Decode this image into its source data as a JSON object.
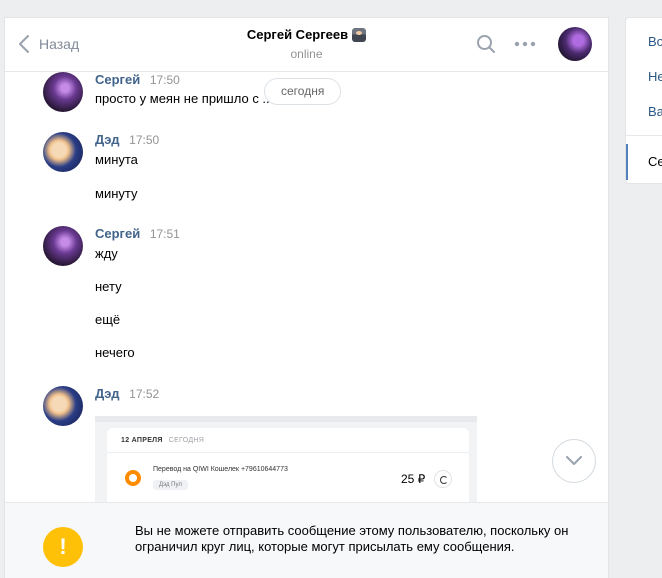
{
  "header": {
    "back_label": "Назад",
    "peer_name": "Сергей Сергеев",
    "peer_status": "online"
  },
  "date_separator": "сегодня",
  "messages": [
    {
      "author": "Сергей",
      "time": "17:50",
      "lines": [
        "просто у меян не пришло с ..."
      ]
    },
    {
      "author": "Дэд",
      "time": "17:50",
      "lines": [
        "минута",
        "минуту"
      ]
    },
    {
      "author": "Сергей",
      "time": "17:51",
      "lines": [
        "жду",
        "нету",
        "ещё",
        "нечего"
      ]
    },
    {
      "author": "Дэд",
      "time": "17:52",
      "attachment": {
        "date": "12 АПРЕЛЯ",
        "date_note": "СЕГОДНЯ",
        "description": "Перевод на QIWI Кошелек +79610644773",
        "tag": "Дэд Пул",
        "amount": "25 ₽"
      }
    }
  ],
  "footer": {
    "warning_icon_glyph": "!",
    "warning_text": "Вы не можете отправить сообщение этому пользователю, поскольку он ограничил круг лиц, которые могут присылать ему сообщения."
  },
  "side_menu": {
    "items": [
      "Во",
      "Не",
      "Ва",
      "Се"
    ]
  },
  "colors": {
    "link": "#42648b",
    "warning": "#ffc107",
    "accent": "#5181b8"
  },
  "icons": [
    "chevron-left-icon",
    "search-icon",
    "more-icon",
    "chevron-down-icon",
    "warning-icon"
  ]
}
